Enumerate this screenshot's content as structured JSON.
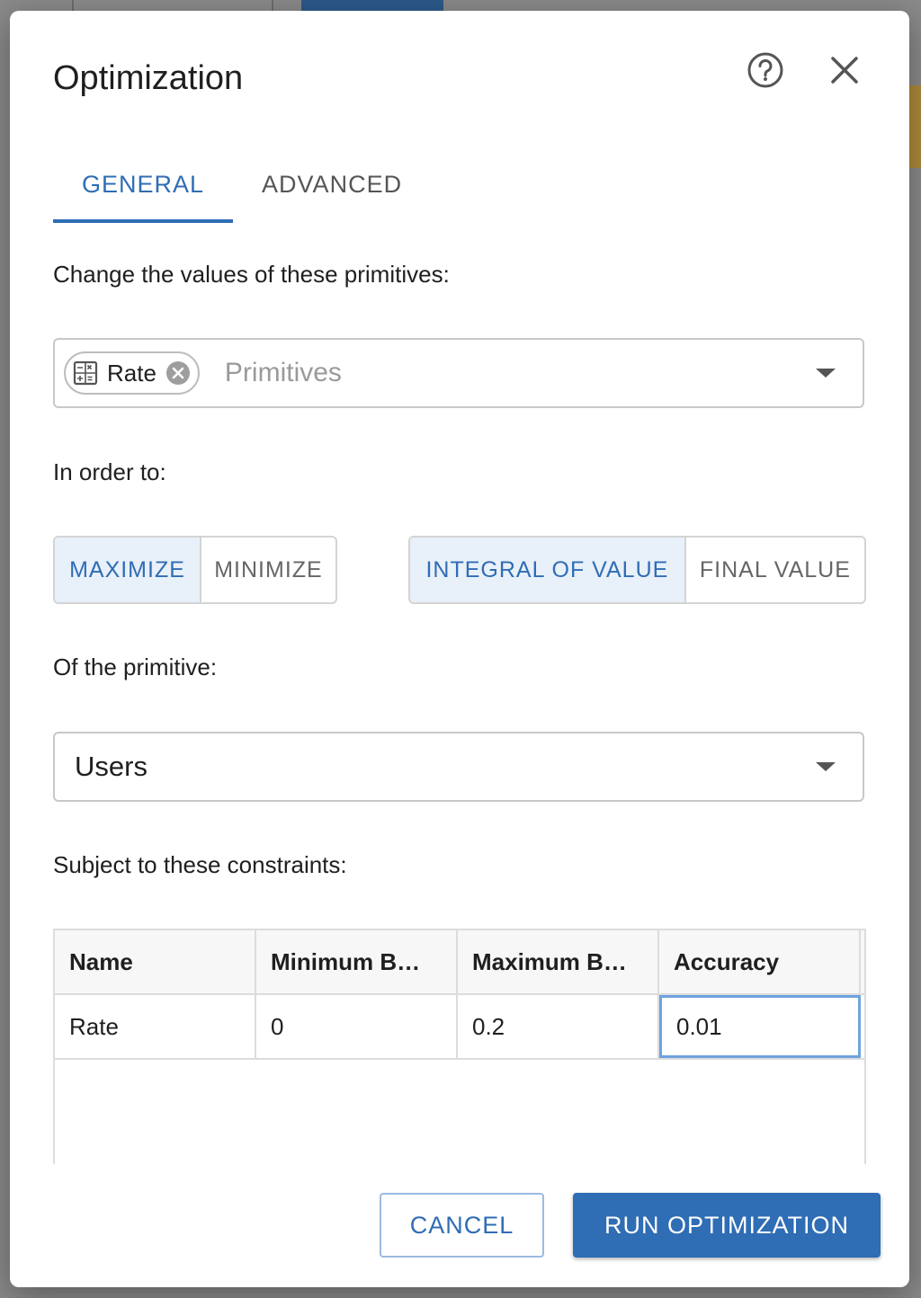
{
  "dialog": {
    "title": "Optimization"
  },
  "icons": {
    "help": "help-circle-icon",
    "close": "close-icon",
    "chip": "calculator-icon",
    "chip_remove": "remove-circle-icon",
    "dropdown": "caret-down-icon"
  },
  "colors": {
    "accent": "#2f6db5",
    "selected_bg": "#e8f0f9"
  },
  "tabs": [
    {
      "label": "GENERAL",
      "active": true
    },
    {
      "label": "ADVANCED",
      "active": false
    }
  ],
  "general": {
    "primitives_label": "Change the values of these primitives:",
    "primitives_select": {
      "chips": [
        "Rate"
      ],
      "placeholder": "Primitives"
    },
    "order_label": "In order to:",
    "goal_toggle": {
      "options": [
        "MAXIMIZE",
        "MINIMIZE"
      ],
      "selected": "MAXIMIZE"
    },
    "measure_toggle": {
      "options": [
        "INTEGRAL OF VALUE",
        "FINAL VALUE"
      ],
      "selected": "INTEGRAL OF VALUE"
    },
    "primitive_label": "Of the primitive:",
    "primitive_select": {
      "value": "Users"
    },
    "constraints_label": "Subject to these constraints:",
    "constraints_table": {
      "columns": [
        "Name",
        "Minimum B…",
        "Maximum B…",
        "Accuracy"
      ],
      "rows": [
        [
          "Rate",
          "0",
          "0.2",
          "0.01"
        ]
      ]
    }
  },
  "footer": {
    "cancel_label": "CANCEL",
    "run_label": "RUN OPTIMIZATION"
  }
}
